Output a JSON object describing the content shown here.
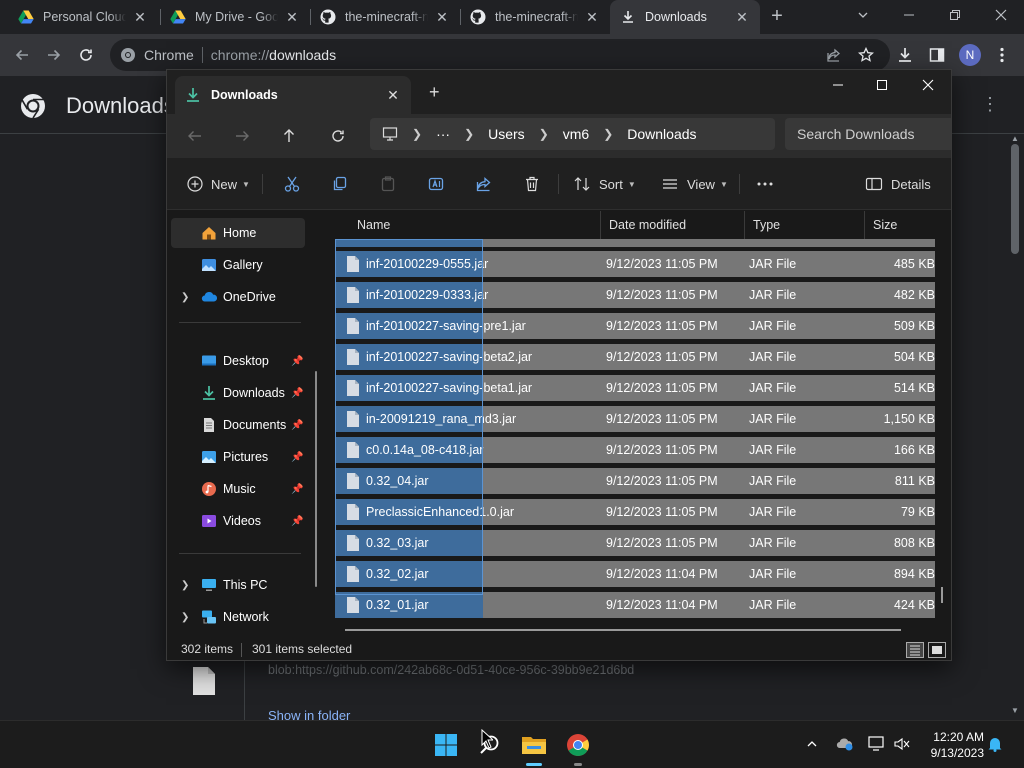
{
  "chrome": {
    "tabs": [
      {
        "label": "Personal Cloud",
        "icon": "google-drive-icon"
      },
      {
        "label": "My Drive - Goo",
        "icon": "google-drive-icon"
      },
      {
        "label": "the-minecraft-n",
        "icon": "github-icon"
      },
      {
        "label": "the-minecraft-n",
        "icon": "github-icon"
      },
      {
        "label": "Downloads",
        "icon": "download-icon"
      }
    ],
    "omnibox": {
      "site": "Chrome",
      "scheme": "chrome://",
      "path": "downloads"
    },
    "profile_initial": "N",
    "page": {
      "title": "Downloads",
      "download_url": "blob:https://github.com/242ab68c-0d51-40ce-956c-39bb9e21d6bd",
      "show_in_folder": "Show in folder"
    }
  },
  "explorer": {
    "tab_label": "Downloads",
    "breadcrumb": {
      "ellipsis": "···",
      "items": [
        "Users",
        "vm6",
        "Downloads"
      ]
    },
    "search_placeholder": "Search Downloads",
    "commands": {
      "new": "New",
      "sort": "Sort",
      "view": "View",
      "details": "Details"
    },
    "nav": [
      {
        "label": "Home",
        "icon": "home-icon"
      },
      {
        "label": "Gallery",
        "icon": "gallery-icon"
      },
      {
        "label": "OneDrive",
        "icon": "onedrive-icon"
      },
      {
        "label": "Desktop",
        "icon": "desktop-icon"
      },
      {
        "label": "Downloads",
        "icon": "downloads-icon"
      },
      {
        "label": "Documents",
        "icon": "documents-icon"
      },
      {
        "label": "Pictures",
        "icon": "pictures-icon"
      },
      {
        "label": "Music",
        "icon": "music-icon"
      },
      {
        "label": "Videos",
        "icon": "videos-icon"
      },
      {
        "label": "This PC",
        "icon": "this-pc-icon"
      },
      {
        "label": "Network",
        "icon": "network-icon"
      }
    ],
    "columns": {
      "name": "Name",
      "date": "Date modified",
      "type": "Type",
      "size": "Size"
    },
    "files": [
      {
        "name": "inf-20100229-0555.jar",
        "date": "9/12/2023 11:05 PM",
        "type": "JAR File",
        "size": "485 KB"
      },
      {
        "name": "inf-20100229-0333.jar",
        "date": "9/12/2023 11:05 PM",
        "type": "JAR File",
        "size": "482 KB"
      },
      {
        "name": "inf-20100227-saving-pre1.jar",
        "date": "9/12/2023 11:05 PM",
        "type": "JAR File",
        "size": "509 KB"
      },
      {
        "name": "inf-20100227-saving-beta2.jar",
        "date": "9/12/2023 11:05 PM",
        "type": "JAR File",
        "size": "504 KB"
      },
      {
        "name": "inf-20100227-saving-beta1.jar",
        "date": "9/12/2023 11:05 PM",
        "type": "JAR File",
        "size": "514 KB"
      },
      {
        "name": "in-20091219_rana_md3.jar",
        "date": "9/12/2023 11:05 PM",
        "type": "JAR File",
        "size": "1,150 KB"
      },
      {
        "name": "c0.0.14a_08-c418.jar",
        "date": "9/12/2023 11:05 PM",
        "type": "JAR File",
        "size": "166 KB"
      },
      {
        "name": "0.32_04.jar",
        "date": "9/12/2023 11:05 PM",
        "type": "JAR File",
        "size": "811 KB"
      },
      {
        "name": "PreclassicEnhanced1.0.jar",
        "date": "9/12/2023 11:05 PM",
        "type": "JAR File",
        "size": "79 KB"
      },
      {
        "name": "0.32_03.jar",
        "date": "9/12/2023 11:05 PM",
        "type": "JAR File",
        "size": "808 KB"
      },
      {
        "name": "0.32_02.jar",
        "date": "9/12/2023 11:04 PM",
        "type": "JAR File",
        "size": "894 KB"
      },
      {
        "name": "0.32_01.jar",
        "date": "9/12/2023 11:04 PM",
        "type": "JAR File",
        "size": "424 KB"
      }
    ],
    "status": {
      "count": "302 items",
      "selected": "301 items selected"
    }
  },
  "taskbar": {
    "time": "12:20 AM",
    "date": "9/13/2023",
    "apps": [
      "windows-start-icon",
      "search-icon",
      "file-explorer-icon",
      "chrome-icon"
    ]
  },
  "colors": {
    "selection": "#3e6c9c",
    "selection_border": "#5b93d1",
    "row_gray": "#777777",
    "accent_blue": "#8ab4f8"
  }
}
